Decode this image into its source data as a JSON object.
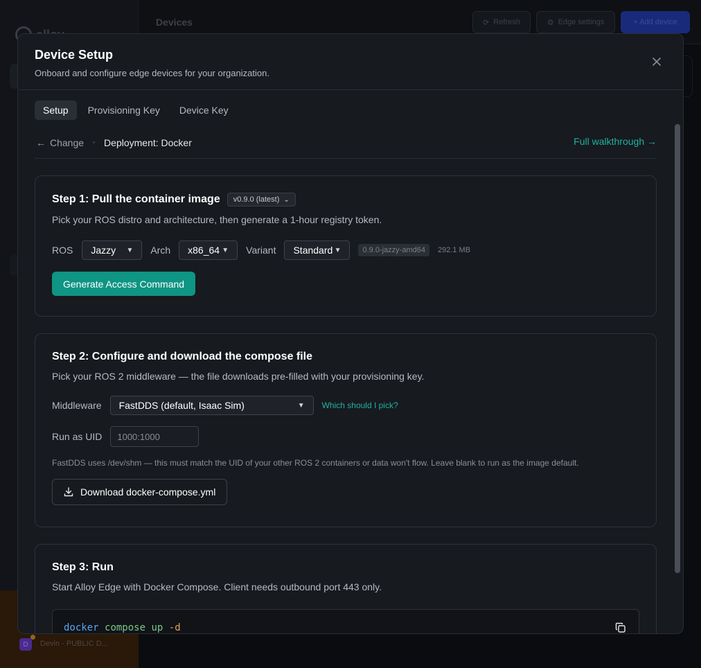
{
  "background": {
    "logo_text": "alloy",
    "page_title": "Devices",
    "refresh_label": "Refresh",
    "edge_settings_label": "Edge settings",
    "add_device_label": "+ Add device",
    "footer_workspace": "Devin - PUBLIC D..."
  },
  "modal": {
    "title": "Device Setup",
    "subtitle": "Onboard and configure edge devices for your organization.",
    "close_icon": "close-icon",
    "tabs": [
      {
        "label": "Setup",
        "active": true
      },
      {
        "label": "Provisioning Key",
        "active": false
      },
      {
        "label": "Device Key",
        "active": false
      }
    ],
    "change_label": "Change",
    "deployment_label": "Deployment: Docker",
    "walkthrough_label": "Full walkthrough →"
  },
  "step1": {
    "title": "Step 1: Pull the container image",
    "version": "v0.9.0 (latest)",
    "description": "Pick your ROS distro and architecture, then generate a 1-hour registry token.",
    "ros_label": "ROS",
    "ros_value": "Jazzy",
    "arch_label": "Arch",
    "arch_value": "x86_64",
    "variant_label": "Variant",
    "variant_value": "Standard",
    "image_tag": "0.9.0-jazzy-amd64",
    "image_size": "292.1 MB",
    "generate_label": "Generate Access Command"
  },
  "step2": {
    "title": "Step 2: Configure and download the compose file",
    "description": "Pick your ROS 2 middleware — the file downloads pre-filled with your provisioning key.",
    "middleware_label": "Middleware",
    "middleware_value": "FastDDS (default, Isaac Sim)",
    "which_link": "Which should I pick?",
    "uid_label": "Run as UID",
    "uid_placeholder": "1000:1000",
    "note": "FastDDS uses /dev/shm — this must match the UID of your other ROS 2 containers or data won't flow. Leave blank to run as the image default.",
    "download_label": "Download docker-compose.yml"
  },
  "step3": {
    "title": "Step 3: Run",
    "description": "Start Alloy Edge with Docker Compose. Client needs outbound port 443 only.",
    "code": {
      "cmd": "docker",
      "arg1": "compose",
      "arg2": "up",
      "flag": "-d"
    }
  },
  "colors": {
    "accent": "#0f9583",
    "link": "#20b2a0",
    "modal_bg": "#171a1f"
  }
}
